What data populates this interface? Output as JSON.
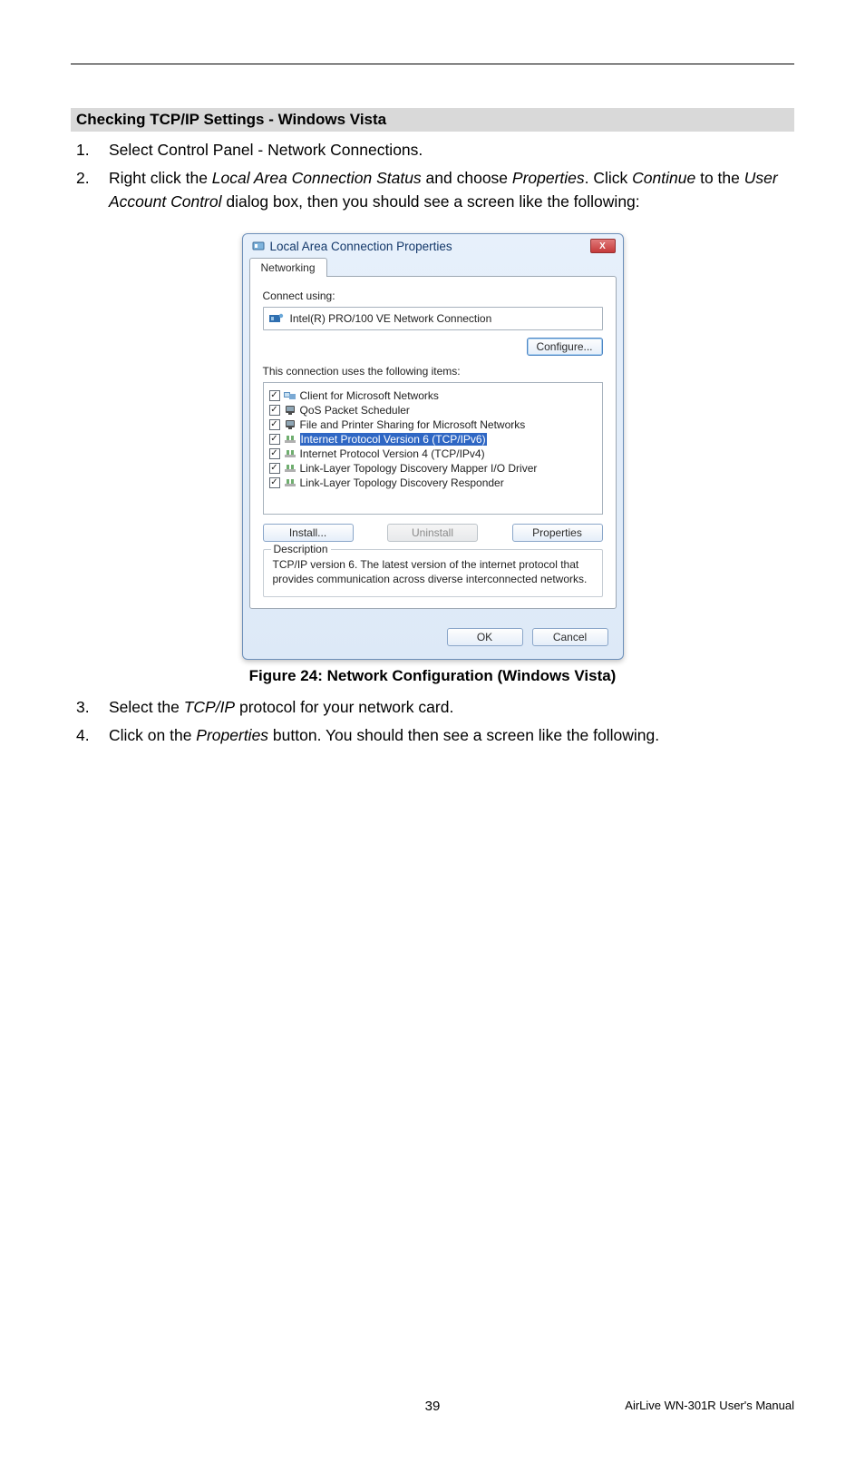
{
  "section_heading": "Checking TCP/IP Settings - Windows Vista",
  "steps": {
    "s1": {
      "num": "1.",
      "text": "Select Control Panel - Network Connections."
    },
    "s2": {
      "num": "2.",
      "pre": "Right click the ",
      "em1": "Local Area Connection Status",
      "mid1": " and choose ",
      "em2": "Properties",
      "mid2": ". Click ",
      "em3": "Continue",
      "mid3": " to the ",
      "em4": "User Account Control",
      "post": " dialog box, then you should see a screen like the following:"
    },
    "s3": {
      "num": "3.",
      "pre": "Select the ",
      "em": "TCP/IP",
      "post": " protocol for your network card."
    },
    "s4": {
      "num": "4.",
      "pre": "Click on the ",
      "em": "Properties",
      "post": " button. You should then see a screen like the following."
    }
  },
  "dialog": {
    "title": "Local Area Connection Properties",
    "close": "X",
    "tab": "Networking",
    "connect_using": "Connect using:",
    "adapter": "Intel(R) PRO/100 VE Network Connection",
    "configure": "Configure...",
    "items_label": "This connection uses the following items:",
    "items": [
      {
        "label": "Client for Microsoft Networks",
        "selected": false,
        "icon": "client"
      },
      {
        "label": "QoS Packet Scheduler",
        "selected": false,
        "icon": "qos"
      },
      {
        "label": "File and Printer Sharing for Microsoft Networks",
        "selected": false,
        "icon": "share"
      },
      {
        "label": "Internet Protocol Version 6 (TCP/IPv6)",
        "selected": true,
        "icon": "proto"
      },
      {
        "label": "Internet Protocol Version 4 (TCP/IPv4)",
        "selected": false,
        "icon": "proto"
      },
      {
        "label": "Link-Layer Topology Discovery Mapper I/O Driver",
        "selected": false,
        "icon": "proto"
      },
      {
        "label": "Link-Layer Topology Discovery Responder",
        "selected": false,
        "icon": "proto"
      }
    ],
    "install": "Install...",
    "uninstall": "Uninstall",
    "properties": "Properties",
    "description_legend": "Description",
    "description_text": "TCP/IP version 6. The latest version of the internet protocol that provides communication across diverse interconnected networks.",
    "ok": "OK",
    "cancel": "Cancel"
  },
  "figure_caption": "Figure 24: Network Configuration (Windows Vista)",
  "footer": {
    "page": "39",
    "manual": "AirLive WN-301R User's Manual"
  }
}
